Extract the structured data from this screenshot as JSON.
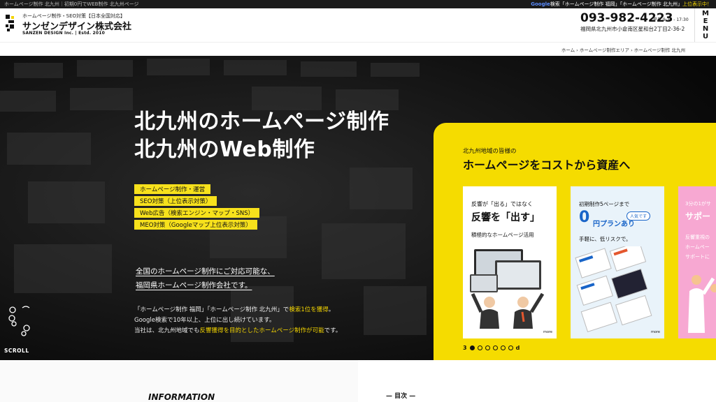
{
  "topbar": {
    "left": "ホームページ制作 北九州｜初期0円でWEB制作 北九州ページ",
    "right_google": "Google",
    "right_text": "検索「ホームページ制作 福岡」「ホームページ制作 北九州」",
    "right_highlight": "上位表示中！"
  },
  "header": {
    "logo_sub": "ホームページ制作・SEO対策【日本全国対応】",
    "logo_name": "サンゼンデザイン株式会社",
    "logo_en": "SANZEN DESIGN Inc. | Estd. 2010",
    "phone": "093-982-4223",
    "hours": "平日 9:30 - 17:30",
    "address": "福岡県北九州市小倉南区星和台2丁目2-36-2",
    "menu_label": [
      "M",
      "E",
      "N",
      "U"
    ]
  },
  "breadcrumb": "ホーム › ホームページ制作エリア › ホームページ制作 北九州",
  "hero": {
    "title_line1": "北九州のホームページ制作",
    "title_line2": "北九州のWeb制作",
    "tags": [
      "ホームページ制作・運営",
      "SEO対策（上位表示対策）",
      "Web広告（検索エンジン・マップ・SNS）",
      "MEO対策（Googleマップ上位表示対策）"
    ],
    "lead_line1": "全国のホームページ制作にご対応可能な、",
    "lead_line2": "福岡県ホームページ制作会社です。",
    "desc_line1_a": "「ホームページ制作 福岡」「ホームページ制作 北九州」で",
    "desc_line1_b": "検索1位を獲得",
    "desc_line1_c": "。",
    "desc_line2": "Google検索で10年以上、上位に出し続けています。",
    "desc_line3_a": "当社は、北九州地域でも",
    "desc_line3_b": "反響獲得を目的としたホームページ制作が可能",
    "desc_line3_c": "です。",
    "scroll": "SCROLL"
  },
  "panel": {
    "kicker": "北九州地域の皆様の",
    "title": "ホームページをコストから資産へ",
    "card1": {
      "head1": "反響が「出る」ではなく",
      "head2": "反響を「出す」",
      "sub": "積極的なホームページ活用",
      "more": "more"
    },
    "card2": {
      "head1": "初期制作5ページまで",
      "badge": "人気です",
      "big": "0",
      "plan": "円プランあり",
      "sub": "手軽に、低リスクで。",
      "more": "more"
    },
    "card3": {
      "t1": "3分の1がサ",
      "t2": "サポー",
      "t3a": "反響重視の",
      "t3b": "ホームペー",
      "t3c": "サポートに"
    },
    "pager_start": "3",
    "pager_end": "d",
    "pager_active": 0,
    "pager_count": 6
  },
  "bottom": {
    "info_title": "INFORMATION",
    "toc_title": "— 目次 —"
  },
  "colors": {
    "accent": "#f5dc00",
    "blue": "#1864c8"
  }
}
